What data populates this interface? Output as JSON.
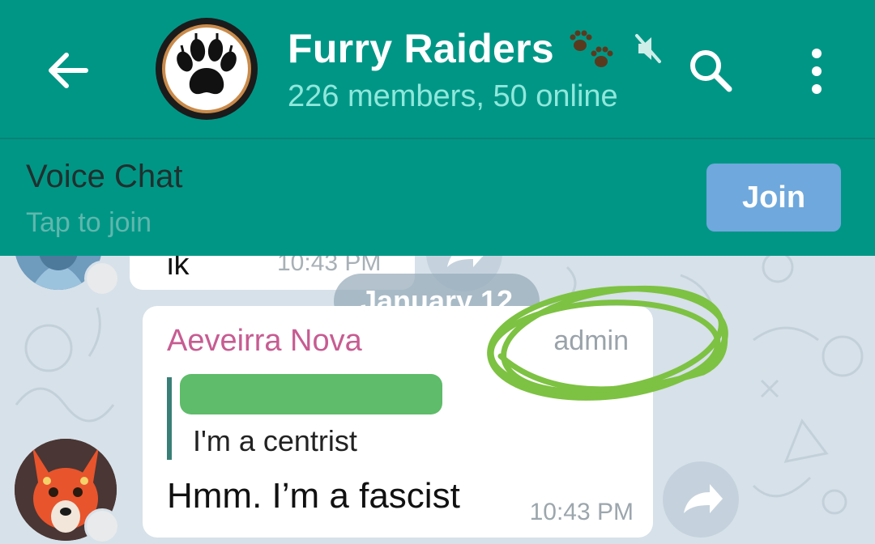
{
  "header": {
    "title": "Furry Raiders",
    "subtitle": "226 members, 50 online",
    "icons": {
      "back": "arrow-left-icon",
      "search": "search-icon",
      "more": "more-vertical-icon",
      "muted": "muted-speaker-icon",
      "title_emoji": "paw-prints-icon"
    }
  },
  "voice_chat": {
    "title": "Voice Chat",
    "subtitle": "Tap to join",
    "join_label": "Join"
  },
  "previous_message": {
    "text": "ik",
    "time": "10:43 PM"
  },
  "date_separator": "January 12",
  "message": {
    "sender": "Aeveirra Nova",
    "role": "admin",
    "reply_text": "I'm a centrist",
    "text": "Hmm. I’m a fascist",
    "time": "10:43 PM"
  },
  "colors": {
    "header": "#009686",
    "join_button": "#6fa8dc",
    "sender_name": "#c75c92",
    "scribble": "#7dc242",
    "chat_background": "#d7e1e9"
  }
}
